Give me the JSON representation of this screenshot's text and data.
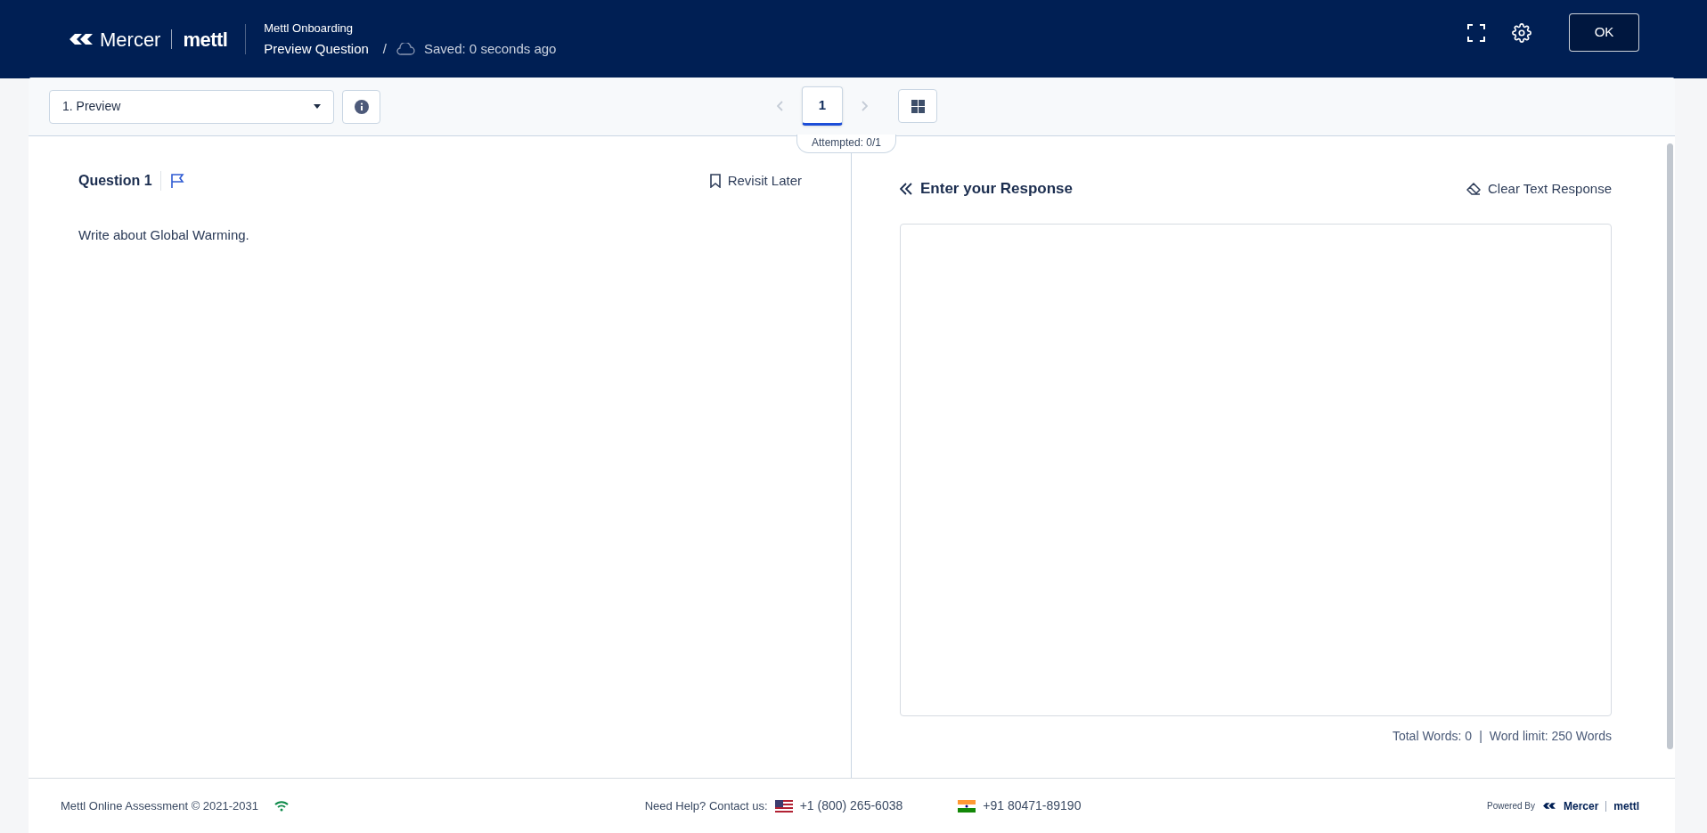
{
  "header": {
    "brand": "Mercer",
    "product": "mettl",
    "course": "Mettl Onboarding",
    "page": "Preview Question",
    "separator": "/",
    "save_status": "Saved: 0 seconds ago",
    "ok_button": "OK"
  },
  "toolbar": {
    "section_select": "1. Preview",
    "pages": [
      {
        "label": "1",
        "selected": true
      }
    ],
    "prev_disabled": true,
    "next_disabled": true,
    "attempted": "Attempted: 0/1"
  },
  "question": {
    "title": "Question 1",
    "flagged": false,
    "revisit_label": "Revisit Later",
    "text": "Write about Global Warming."
  },
  "response": {
    "title": "Enter your Response",
    "clear_label": "Clear Text Response",
    "total_words": "Total Words: 0",
    "separator": "|",
    "word_limit": "Word limit: 250 Words"
  },
  "footer": {
    "copyright": "Mettl Online Assessment © 2021-2031",
    "help": "Need Help? Contact us:",
    "phones": [
      {
        "kind": "us",
        "number": "+1 (800) 265-6038"
      },
      {
        "kind": "in",
        "number": "+91 80471-89190"
      }
    ],
    "powered_by": "Powered By",
    "brand": "Mercer",
    "product": "mettl"
  }
}
